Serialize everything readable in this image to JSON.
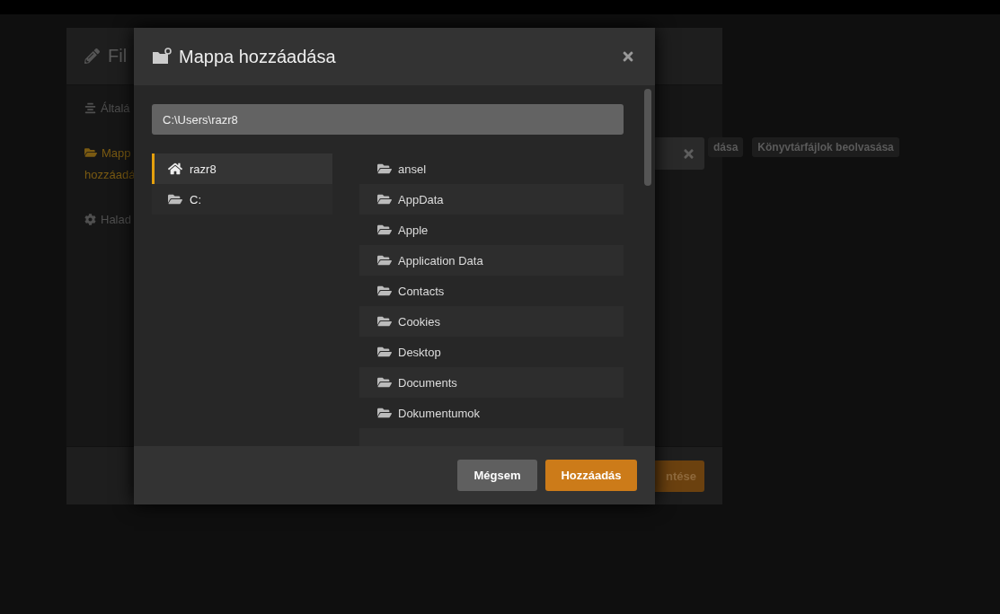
{
  "background_dialog": {
    "title": "Fil",
    "sidebar": [
      {
        "label": "Általá",
        "kind": "list",
        "selected": false
      },
      {
        "label": "Mapp hozzáadá",
        "kind": "folder",
        "selected": true
      },
      {
        "label": "Halad",
        "kind": "gear",
        "selected": false
      }
    ],
    "tags": [
      "dása",
      "Könyvtárfájlok beolvasása"
    ],
    "footer_button": "ntése"
  },
  "dialog": {
    "title": "Mappa hozzáadása",
    "path": "C:\\Users\\razr8",
    "locations": [
      {
        "label": "razr8",
        "kind": "home",
        "selected": true
      },
      {
        "label": "C:",
        "kind": "drive",
        "selected": false
      }
    ],
    "folders": [
      "ansel",
      "AppData",
      "Apple",
      "Application Data",
      "Contacts",
      "Cookies",
      "Desktop",
      "Documents",
      "Dokumentumok"
    ],
    "buttons": [
      {
        "label": "Mégsem",
        "kind": "secondary"
      },
      {
        "label": "Hozzáadás",
        "kind": "primary"
      }
    ]
  }
}
